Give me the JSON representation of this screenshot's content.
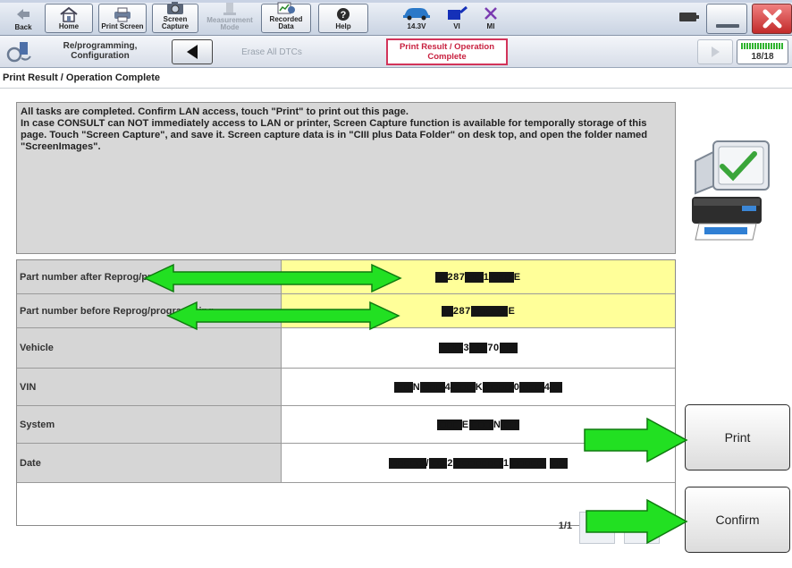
{
  "toolbar": {
    "back_label": "Back",
    "home_label": "Home",
    "print_screen_label": "Print Screen",
    "screen_capture_label": "Screen Capture",
    "measurement_mode_label": "Measurement Mode",
    "recorded_data_label": "Recorded Data",
    "help_label": "Help",
    "voltage": "14.3V",
    "vi_label": "VI",
    "mi_label": "MI"
  },
  "nav": {
    "section_label": "Re/programming, Configuration",
    "erase_dtcs_label": "Erase All DTCs",
    "current_step_label": "Print Result / Operation Complete",
    "progress_text": "18/18",
    "progress_fraction": 1.0
  },
  "page": {
    "title": "Print Result / Operation Complete",
    "message": "All tasks are completed. Confirm LAN access, touch \"Print\" to print out this page.\nIn case CONSULT can NOT immediately access to LAN or printer, Screen Capture function is available for temporally storage of this page. Touch \"Screen Capture\", and save it. Screen capture data is in \"CIII plus Data Folder\" on desk top, and open the folder named \"ScreenImages\"."
  },
  "results": [
    {
      "label": "Part number after Reprog/programming",
      "value": "■287■■1■■■E",
      "highlight": true
    },
    {
      "label": "Part number before Reprog/programming",
      "value": "■287■■■■■E",
      "highlight": true
    },
    {
      "label": "Vehicle",
      "value": "■■■3■■70■■",
      "highlight": false
    },
    {
      "label": "VIN",
      "value": "■■N■■■4■■■K■■■■0■■■4■",
      "highlight": false
    },
    {
      "label": "System",
      "value": "■■■E■■■N■■",
      "highlight": false
    },
    {
      "label": "Date",
      "value": "■■■■■/■■2■■■■■■■1■■■■■ ■■",
      "highlight": false
    }
  ],
  "pager": {
    "text": "1/1"
  },
  "actions": {
    "print_label": "Print",
    "confirm_label": "Confirm"
  },
  "colors": {
    "highlight_yellow": "#ffff99",
    "step_tab_red": "#d2345a",
    "annotation_arrow_green": "#22e022",
    "progress_green": "#2fb32f"
  }
}
